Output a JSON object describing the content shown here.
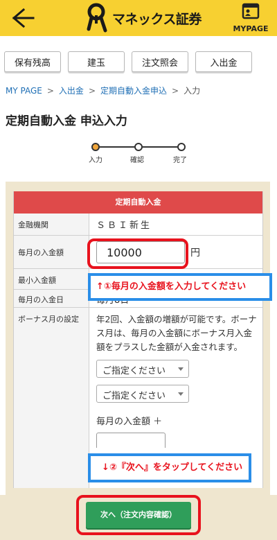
{
  "header": {
    "brand": "マネックス証券",
    "mypage_label": "MYPAGE"
  },
  "tabs": [
    {
      "label": "保有残高"
    },
    {
      "label": "建玉"
    },
    {
      "label": "注文照会"
    },
    {
      "label": "入出金"
    }
  ],
  "breadcrumb": [
    {
      "label": "MY PAGE"
    },
    {
      "label": "入出金"
    },
    {
      "label": "定期自動入金申込"
    },
    {
      "label": "入力"
    }
  ],
  "page_title": "定期自動入金 申込入力",
  "steps": [
    {
      "label": "入力",
      "active": true
    },
    {
      "label": "確認",
      "active": false
    },
    {
      "label": "完了",
      "active": false
    }
  ],
  "form": {
    "table_title": "定期自動入金",
    "bank_label": "金融機関",
    "bank_value": "ＳＢＩ新生",
    "amount_label": "毎月の入金額",
    "amount_value": "10000",
    "amount_unit": "円",
    "min_label": "最小入金額",
    "day_label": "毎月の入金日",
    "day_value": "毎月8日",
    "bonus_label": "ボーナス月の設定",
    "bonus_desc": "年2回、入金額の増額が可能です。ボーナス月は、毎月の入金額にボーナス月入金額をプラスした金額が入金されます。",
    "bonus_select_1": "ご指定ください",
    "bonus_select_2": "ご指定ください",
    "bonus_amount_label": "毎月の入金額 ＋"
  },
  "annotations": {
    "callout_1": "↑①毎月の入金額を入力してください",
    "callout_2": "↓②『次へ』をタップしてください"
  },
  "next_button": "次へ（注文内容確認）",
  "colors": {
    "header_yellow": "#f7d031",
    "table_head_red": "#df4a4a",
    "link_blue": "#1f6fb5",
    "button_green": "#2f9e5a",
    "highlight_red": "#e8121d",
    "callout_blue": "#2a8ee8"
  }
}
